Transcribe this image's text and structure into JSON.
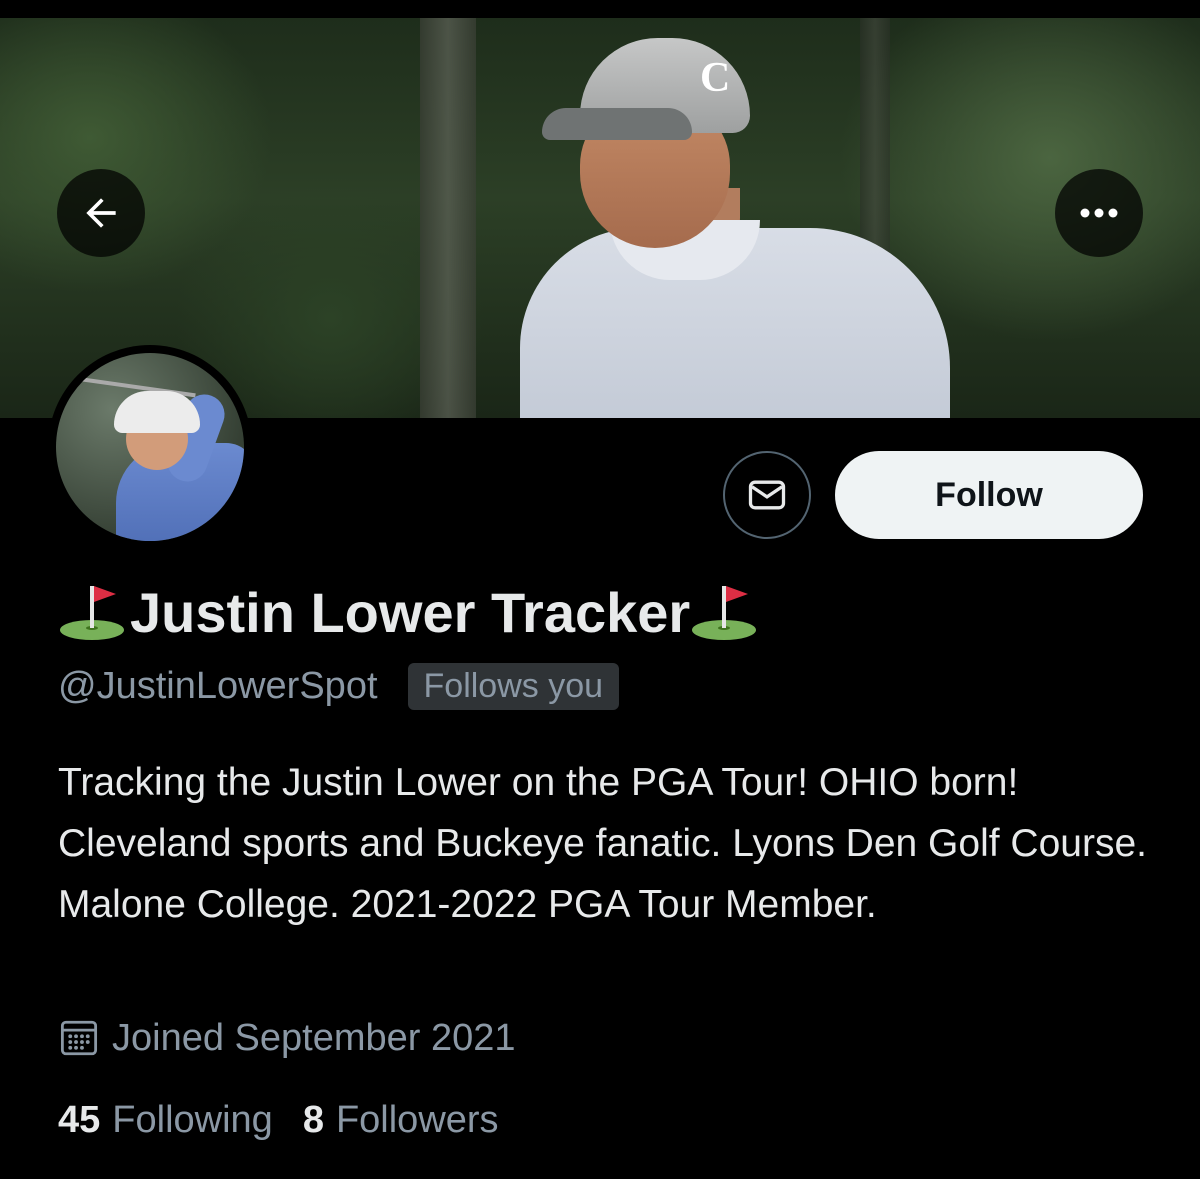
{
  "profile": {
    "display_name": "Justin Lower Tracker",
    "name_decoration_icon": "golf-flag-emoji",
    "handle": "@JustinLowerSpot",
    "follows_you_badge": "Follows you",
    "bio": "Tracking the Justin Lower on the PGA Tour! OHIO born! Cleveland sports and Buckeye fanatic. Lyons Den Golf Course. Malone College. 2021-2022 PGA Tour Member.",
    "joined": "Joined September 2021"
  },
  "stats": {
    "following_count": "45",
    "following_label": "Following",
    "followers_count": "8",
    "followers_label": "Followers"
  },
  "actions": {
    "back_icon": "arrow-left",
    "more_icon": "ellipsis",
    "message_icon": "envelope",
    "follow_label": "Follow"
  },
  "colors": {
    "background": "#000000",
    "text_primary": "#e7e9ea",
    "text_secondary": "#8b98a5",
    "follow_button_bg": "#eff3f4",
    "badge_bg": "#2f3336"
  }
}
